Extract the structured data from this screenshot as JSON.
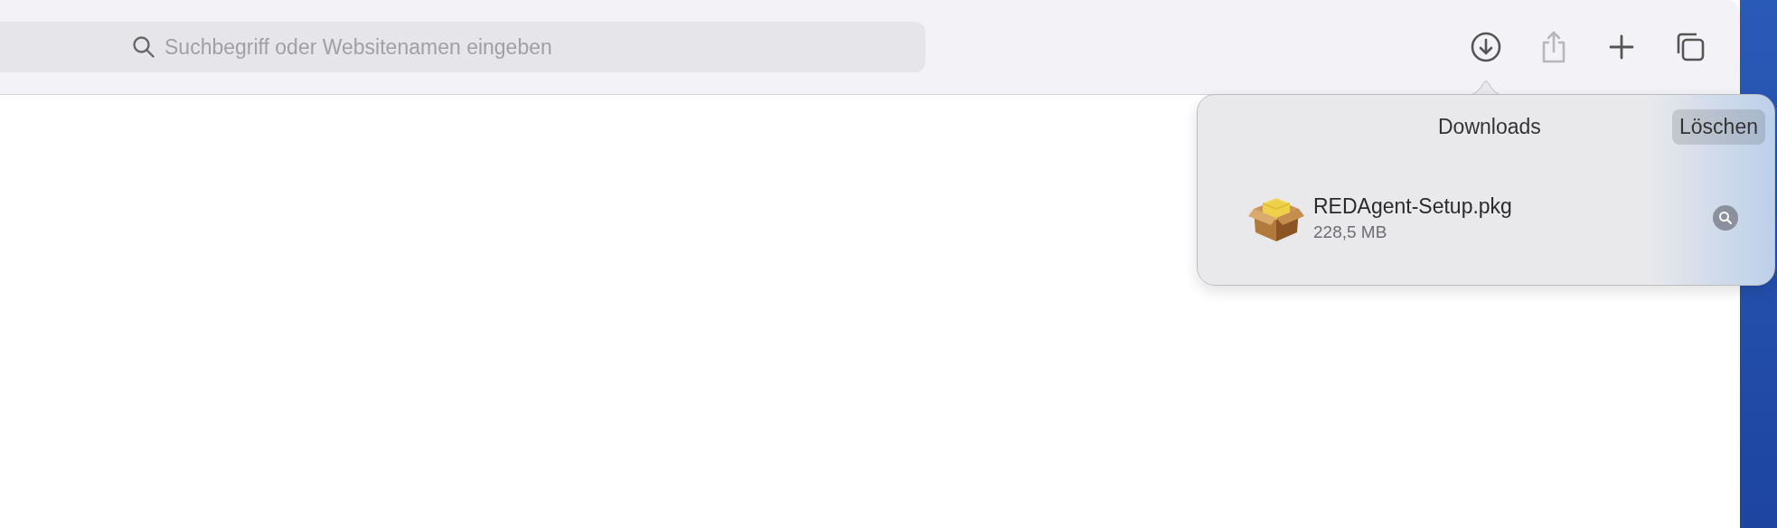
{
  "toolbar": {
    "search": {
      "placeholder": "Suchbegriff oder Websitenamen eingeben"
    },
    "buttons": [
      {
        "kind": "download",
        "disabled": false
      },
      {
        "kind": "share",
        "disabled": true
      },
      {
        "kind": "new-tab",
        "disabled": false
      },
      {
        "kind": "tabs",
        "disabled": false
      }
    ]
  },
  "downloads_popover": {
    "title": "Downloads",
    "clear_button": "Löschen",
    "items": [
      {
        "name": "REDAgent-Setup.pkg",
        "size": "228,5 MB"
      }
    ]
  }
}
